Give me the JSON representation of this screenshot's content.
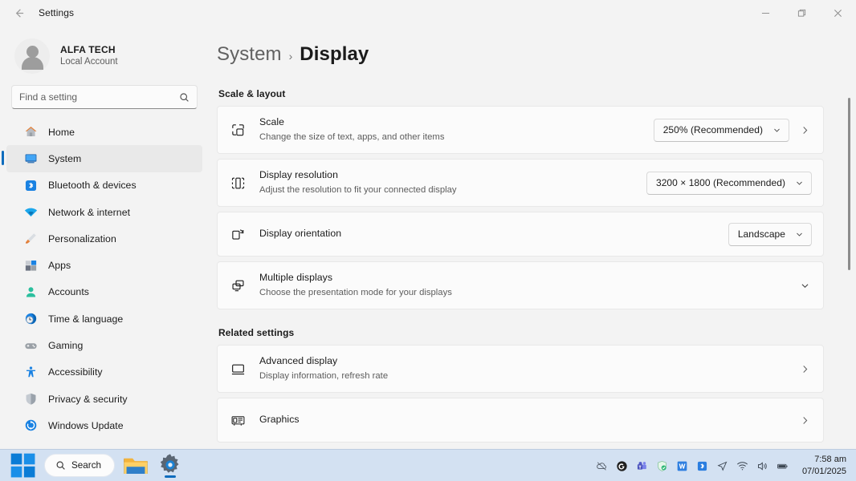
{
  "titlebar": {
    "back_label": "back-arrow",
    "title": "Settings",
    "minimize": "minimize",
    "maximize": "maximize",
    "close": "close"
  },
  "sidebar": {
    "account": {
      "name": "ALFA TECH",
      "subtitle": "Local Account"
    },
    "search": {
      "placeholder": "Find a setting",
      "value": ""
    },
    "items": [
      {
        "label": "Home",
        "icon": "home-icon",
        "active": false
      },
      {
        "label": "System",
        "icon": "system-monitor-icon",
        "active": true
      },
      {
        "label": "Bluetooth & devices",
        "icon": "bluetooth-icon",
        "active": false
      },
      {
        "label": "Network & internet",
        "icon": "wifi-icon",
        "active": false
      },
      {
        "label": "Personalization",
        "icon": "paintbrush-icon",
        "active": false
      },
      {
        "label": "Apps",
        "icon": "apps-icon",
        "active": false
      },
      {
        "label": "Accounts",
        "icon": "person-icon",
        "active": false
      },
      {
        "label": "Time & language",
        "icon": "clock-globe-icon",
        "active": false
      },
      {
        "label": "Gaming",
        "icon": "gamepad-icon",
        "active": false
      },
      {
        "label": "Accessibility",
        "icon": "accessibility-icon",
        "active": false
      },
      {
        "label": "Privacy & security",
        "icon": "shield-icon",
        "active": false
      },
      {
        "label": "Windows Update",
        "icon": "update-icon",
        "active": false
      }
    ]
  },
  "main": {
    "breadcrumb": {
      "parent": "System",
      "separator": "›",
      "current": "Display"
    },
    "sections": [
      {
        "title": "Scale & layout",
        "rows": [
          {
            "icon": "scale-icon",
            "title": "Scale",
            "subtitle": "Change the size of text, apps, and other items",
            "control": "combo",
            "value": "250% (Recommended)",
            "has_row_chevron": true
          },
          {
            "icon": "resolution-icon",
            "title": "Display resolution",
            "subtitle": "Adjust the resolution to fit your connected display",
            "control": "combo",
            "value": "3200 × 1800 (Recommended)",
            "has_row_chevron": false
          },
          {
            "icon": "orientation-icon",
            "title": "Display orientation",
            "subtitle": "",
            "control": "combo",
            "value": "Landscape",
            "has_row_chevron": false
          },
          {
            "icon": "multiple-displays-icon",
            "title": "Multiple displays",
            "subtitle": "Choose the presentation mode for your displays",
            "control": "expander",
            "value": "",
            "has_row_chevron": false
          }
        ]
      },
      {
        "title": "Related settings",
        "rows": [
          {
            "icon": "monitor-icon",
            "title": "Advanced display",
            "subtitle": "Display information, refresh rate",
            "control": "navigate",
            "value": "",
            "has_row_chevron": true
          },
          {
            "icon": "graphics-card-icon",
            "title": "Graphics",
            "subtitle": "",
            "control": "navigate",
            "value": "",
            "has_row_chevron": true
          }
        ]
      }
    ]
  },
  "taskbar": {
    "start": "start-icon",
    "search": {
      "label": "Search",
      "icon": "search-icon"
    },
    "apps": [
      {
        "name": "file-explorer-icon",
        "active": false
      },
      {
        "name": "settings-gear-icon",
        "active": true
      }
    ],
    "tray": [
      "onedrive-paused-icon",
      "grammarly-icon",
      "teams-icon",
      "security-shield-icon",
      "wondershare-icon",
      "bluetooth-icon",
      "location-icon",
      "wifi-icon",
      "volume-icon",
      "battery-icon"
    ],
    "clock": {
      "time": "7:58 am",
      "date": "07/01/2025"
    }
  },
  "colors": {
    "accent": "#0f6cbd",
    "page_bg": "#f3f3f3",
    "card_bg": "#fbfbfb",
    "taskbar_bg": "#d3e1f2"
  }
}
